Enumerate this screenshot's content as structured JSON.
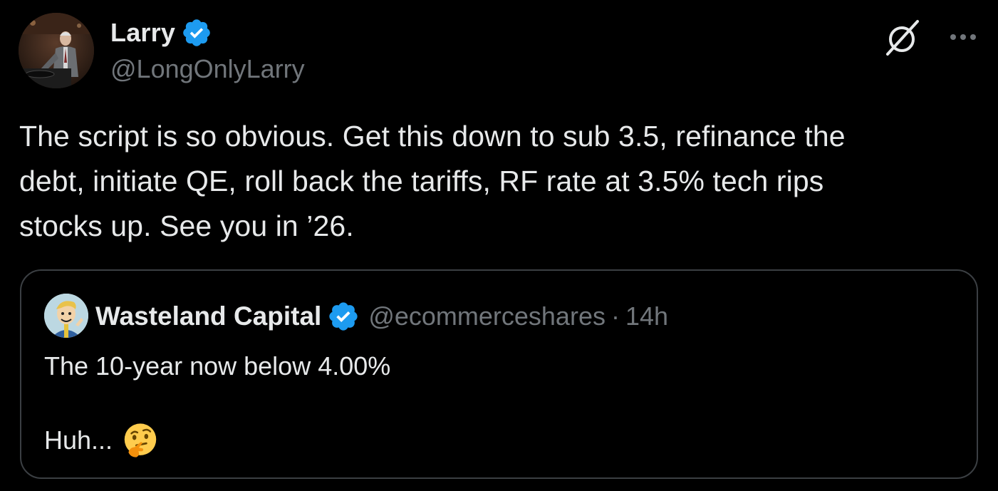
{
  "author": {
    "display_name": "Larry",
    "handle": "@LongOnlyLarry",
    "verified": true,
    "avatar_icon": "avatar-dj-photo"
  },
  "actions": {
    "grok_icon": "grok-icon",
    "more_icon": "more-dots-icon"
  },
  "tweet": {
    "text": "The script is so obvious. Get this down to sub 3.5, refinance the\ndebt, initiate QE, roll back the tariffs, RF rate at 3.5% tech rips\nstocks up. See you in ’26."
  },
  "quote": {
    "display_name": "Wasteland Capital",
    "handle": "@ecommerceshares",
    "separator": "·",
    "time": "14h",
    "verified": true,
    "line1": "The 10-year now below 4.00%",
    "line2": "Huh...",
    "emoji": "thinking-face-emoji"
  },
  "colors": {
    "background": "#000000",
    "text_primary": "#e7e9ea",
    "text_secondary": "#71767b",
    "verified_blue": "#1d9bf0",
    "border": "#3b3f43"
  }
}
